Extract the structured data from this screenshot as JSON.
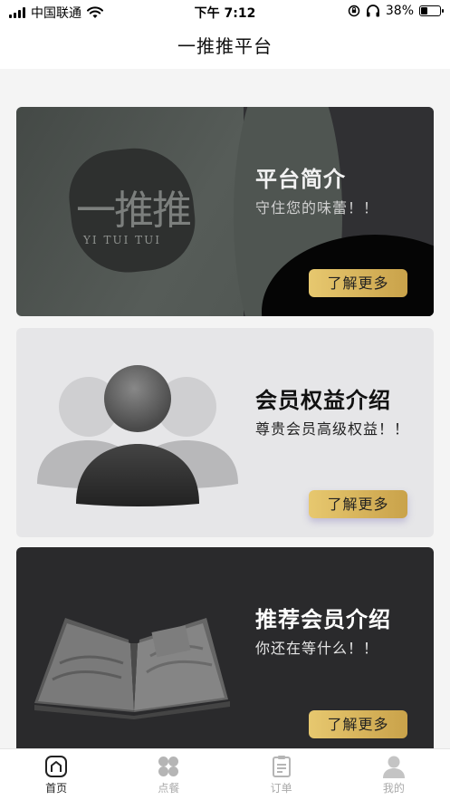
{
  "status_bar": {
    "carrier": "中国联通",
    "time": "下午 7:12",
    "battery": "38%",
    "battery_level": 0.38,
    "icons": [
      "signal-icon",
      "wifi-icon",
      "orientation-lock-icon",
      "headphones-icon",
      "battery-icon"
    ]
  },
  "header": {
    "title": "一推推平台"
  },
  "cards": [
    {
      "title": "平台简介",
      "subtitle": "守住您的味蕾！！",
      "button": "了解更多",
      "logo_text": "一推推",
      "logo_sub": "YI TUI TUI"
    },
    {
      "title": "会员权益介绍",
      "subtitle": "尊贵会员高级权益！！",
      "button": "了解更多",
      "image": "members-icon"
    },
    {
      "title": "推荐会员介绍",
      "subtitle": "你还在等什么！！",
      "button": "了解更多",
      "image": "book-icon"
    }
  ],
  "tabs": [
    {
      "label": "首页",
      "icon": "home-icon",
      "active": true
    },
    {
      "label": "点餐",
      "icon": "grid-icon",
      "active": false
    },
    {
      "label": "订单",
      "icon": "clipboard-icon",
      "active": false
    },
    {
      "label": "我的",
      "icon": "user-icon",
      "active": false
    }
  ],
  "colors": {
    "button_gradient_start": "#e7c86f",
    "button_gradient_end": "#c9a24a",
    "tab_active": "#222222",
    "tab_inactive": "#aaaaaa"
  }
}
